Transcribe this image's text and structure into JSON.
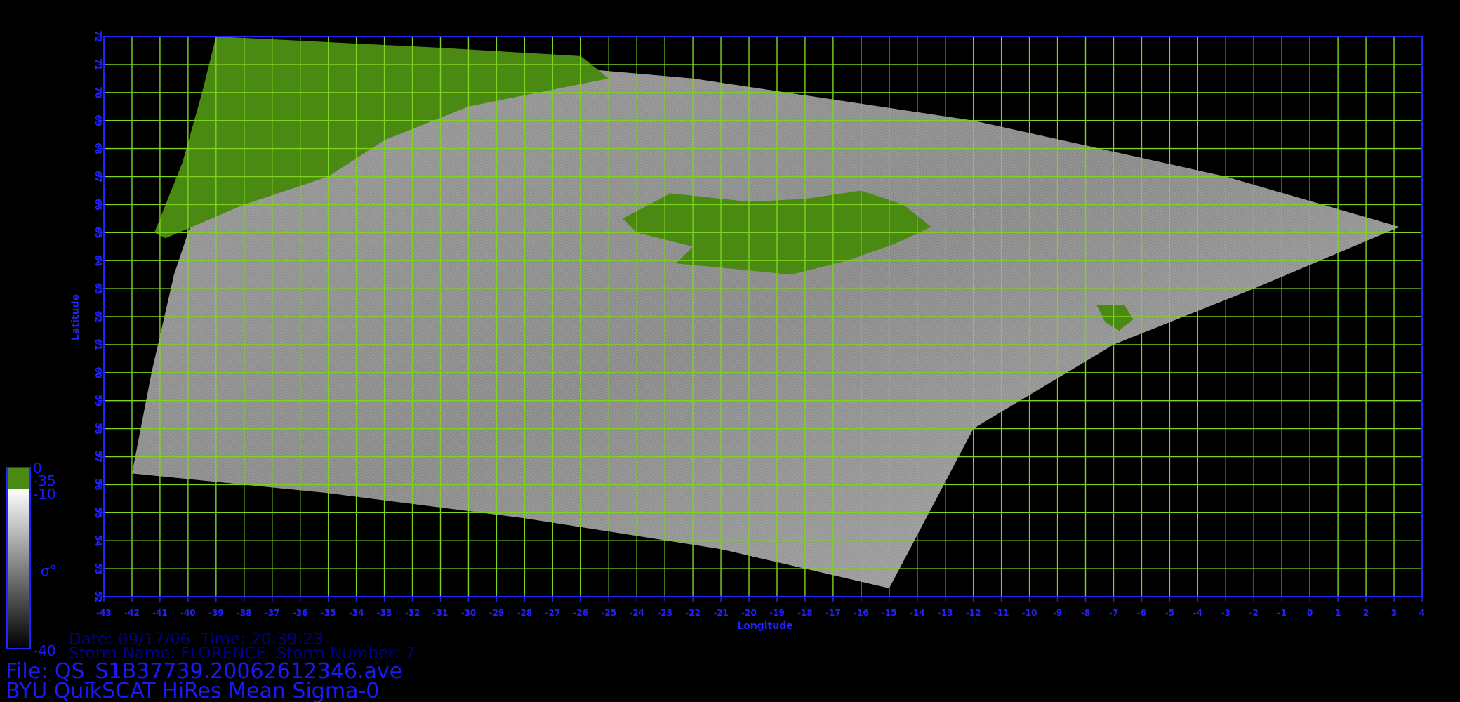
{
  "colors": {
    "background": "#000000",
    "axis": "#2222ff",
    "grid": "#7ed321",
    "land": "#4a8a12",
    "tick_text": "#2222ff",
    "meta_dim": "#000088",
    "meta_bright": "#1a1aff"
  },
  "map": {
    "xlabel": "Longitude",
    "ylabel": "Latitude",
    "lon_range": [
      -43,
      4
    ],
    "lat_range": [
      52,
      72
    ],
    "lon_ticks": [
      -43,
      -42,
      -41,
      -40,
      -39,
      -38,
      -37,
      -36,
      -35,
      -34,
      -33,
      -32,
      -31,
      -30,
      -29,
      -28,
      -27,
      -26,
      -25,
      -24,
      -23,
      -22,
      -21,
      -20,
      -19,
      -18,
      -17,
      -16,
      -15,
      -14,
      -13,
      -12,
      -11,
      -10,
      -9,
      -8,
      -7,
      -6,
      -5,
      -4,
      -3,
      -2,
      -1,
      0,
      1,
      2,
      3,
      4
    ],
    "lat_ticks": [
      52,
      53,
      54,
      55,
      56,
      57,
      58,
      59,
      60,
      61,
      62,
      63,
      64,
      65,
      66,
      67,
      68,
      69,
      70,
      71,
      72
    ],
    "grid": true,
    "swath_outline": [
      [
        -39,
        72
      ],
      [
        -22,
        70.5
      ],
      [
        -12,
        69
      ],
      [
        -3,
        67
      ],
      [
        3.2,
        65.2
      ],
      [
        -2,
        63
      ],
      [
        -7,
        61
      ],
      [
        -12,
        58
      ],
      [
        -15,
        52.3
      ],
      [
        -21,
        53.7
      ],
      [
        -28,
        54.8
      ],
      [
        -35,
        55.7
      ],
      [
        -42,
        56.4
      ],
      [
        -41.3,
        60
      ],
      [
        -40.5,
        63.5
      ],
      [
        -39.5,
        66.5
      ]
    ],
    "land_greenland": [
      [
        -39,
        72
      ],
      [
        -31,
        71.6
      ],
      [
        -26,
        71.3
      ],
      [
        -25,
        70.5
      ],
      [
        -30,
        69.5
      ],
      [
        -33,
        68.3
      ],
      [
        -35,
        67
      ],
      [
        -38,
        66
      ],
      [
        -40.8,
        64.8
      ],
      [
        -41.2,
        65
      ],
      [
        -40.2,
        67.5
      ],
      [
        -39.5,
        70
      ]
    ],
    "land_iceland": [
      [
        -24.5,
        65.5
      ],
      [
        -22.8,
        66.4
      ],
      [
        -20,
        66.1
      ],
      [
        -18,
        66.2
      ],
      [
        -16,
        66.5
      ],
      [
        -14.5,
        66
      ],
      [
        -13.5,
        65.2
      ],
      [
        -14.8,
        64.6
      ],
      [
        -16.5,
        64
      ],
      [
        -18.5,
        63.5
      ],
      [
        -20.5,
        63.7
      ],
      [
        -22.6,
        63.9
      ],
      [
        -22,
        64.5
      ],
      [
        -24,
        65
      ]
    ],
    "land_faroe": [
      [
        -7.6,
        62.4
      ],
      [
        -6.6,
        62.4
      ],
      [
        -6.3,
        61.9
      ],
      [
        -6.8,
        61.5
      ],
      [
        -7.3,
        61.8
      ]
    ]
  },
  "colorbar": {
    "top_value": "0",
    "land_value": "-35",
    "mid_value": "-10",
    "bottom_value": "-40",
    "symbol": "σ°"
  },
  "meta": {
    "date_line": "Date: 09/17/06  Time: 20:39:23",
    "storm_line": "Storm Name: FLORENCE  Storm Number: 7",
    "file_line": "File: QS_S1B37739.20062612346.ave",
    "title_line": "BYU QuikSCAT HiRes Mean Sigma-0"
  }
}
